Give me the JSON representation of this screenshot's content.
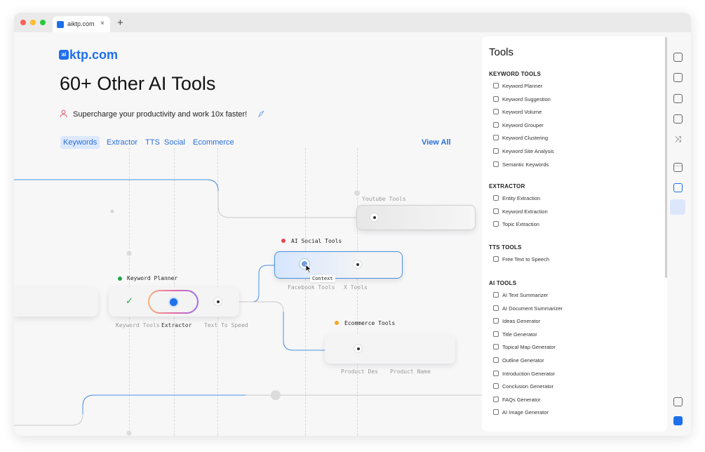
{
  "browser": {
    "tab_title": "aiktp.com",
    "tab_close": "×",
    "new_tab": "+"
  },
  "page": {
    "logo_mark": "ai",
    "logo_text": "ktp.com",
    "headline": "60+ Other AI Tools",
    "subheadline": "Supercharge your productivity and work 10x faster!",
    "categories": [
      "Keywords",
      "Extractor",
      "TTS",
      "Social",
      "Ecommerce"
    ],
    "active_category": "Keywords",
    "view_all": "View All"
  },
  "flow": {
    "youtube_title": "Youtube Tools",
    "social_title": "AI Social Tools",
    "social_labels": [
      "Facebook Tools",
      "X Tools"
    ],
    "context_tooltip": "Context",
    "keyword_planner_title": "Keyword Planner",
    "keyword_labels": [
      "Keyword Tools",
      "Extractor",
      "Text To Speed"
    ],
    "ecommerce_title": "Ecommerce Tools",
    "ecommerce_labels": [
      "Product Des",
      "Product Name"
    ],
    "check_mark": "✓",
    "colors": {
      "keyword_planner": "#22a447",
      "social": "#e5484d",
      "ecommerce": "#f5a524",
      "accent": "#1f6feb"
    }
  },
  "tools_panel": {
    "title": "Tools",
    "sections": [
      {
        "heading": "KEYWORD TOOLS",
        "items": [
          "Keyword Planner",
          "Keyword Suggestion",
          "Keyword Volume",
          "Keyword Grouper",
          "Keyword Clustering",
          "Keyword Site Analysis",
          "Semantic Keywords"
        ]
      },
      {
        "heading": "EXTRACTOR",
        "items": [
          "Entity Extraction",
          "Keyword Extraction",
          "Topic Extraction"
        ]
      },
      {
        "heading": "TTS TOOLS",
        "items": [
          "Free Text to Speech"
        ]
      },
      {
        "heading": "AI TOOLS",
        "items": [
          "AI Text Summarizer",
          "AI Document Summarizer",
          "Ideas Generator",
          "Title Generator",
          "Topical Map Generator",
          "Outline Generator",
          "Introduction Generator",
          "Conclusion Generator",
          "FAQs Generator",
          "AI Image Generator"
        ]
      }
    ]
  },
  "rail_icons": [
    "chat-icon",
    "translate-icon",
    "image-check-icon",
    "document-icon",
    "shuffle-icon",
    "calendar-edit-icon",
    "toolbox-icon",
    "notes-icon",
    "aiktp-logo-icon"
  ]
}
